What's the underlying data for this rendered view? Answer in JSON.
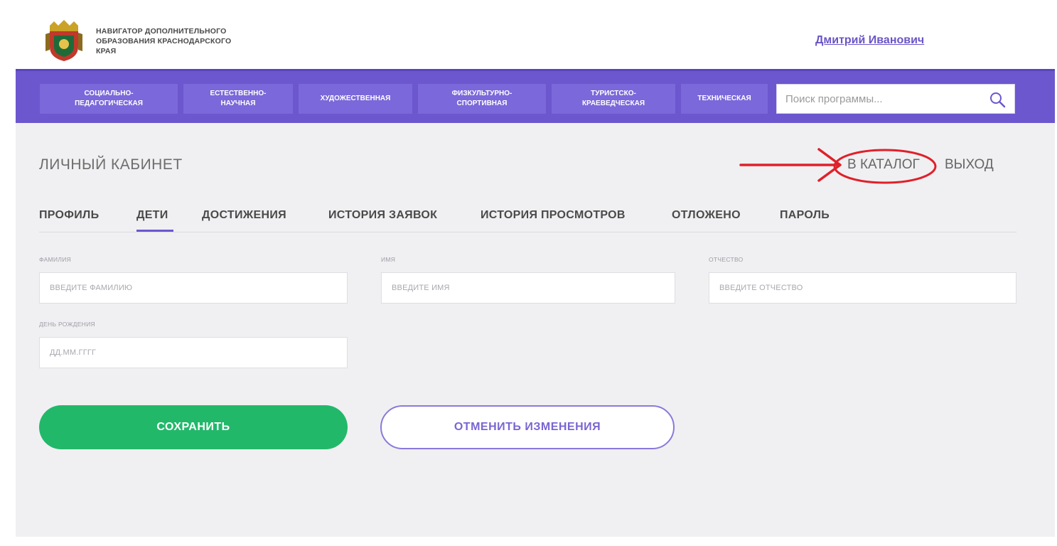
{
  "header": {
    "brand_line1": "НАВИГАТОР ДОПОЛНИТЕЛЬНОГО",
    "brand_line2": "ОБРАЗОВАНИЯ КРАСНОДАРСКОГО",
    "brand_line3": "КРАЯ",
    "user_name": "Дмитрий Иванович",
    "logo_icon": "coat-of-arms-icon"
  },
  "nav": {
    "items": [
      {
        "line1": "СОЦИАЛЬНО-",
        "line2": "ПЕДАГОГИЧЕСКАЯ"
      },
      {
        "line1": "ЕСТЕСТВЕННО-",
        "line2": "НАУЧНАЯ"
      },
      {
        "line1": "ХУДОЖЕСТВЕННАЯ",
        "line2": ""
      },
      {
        "line1": "ФИЗКУЛЬТУРНО-",
        "line2": "СПОРТИВНАЯ"
      },
      {
        "line1": "ТУРИСТСКО-",
        "line2": "КРАЕВЕДЧЕСКАЯ"
      },
      {
        "line1": "ТЕХНИЧЕСКАЯ",
        "line2": ""
      }
    ],
    "search_placeholder": "Поиск программы...",
    "search_icon": "search-icon",
    "accent_color": "#6c57cf"
  },
  "cabinet": {
    "title": "ЛИЧНЫЙ КАБИНЕТ",
    "catalog_link": "В КАТАЛОГ",
    "logout_link": "ВЫХОД",
    "annotation_color": "#e0202a"
  },
  "tabs": [
    {
      "label": "ПРОФИЛЬ"
    },
    {
      "label": "ДЕТИ",
      "active": true
    },
    {
      "label": "ДОСТИЖЕНИЯ"
    },
    {
      "label": "ИСТОРИЯ ЗАЯВОК"
    },
    {
      "label": "ИСТОРИЯ ПРОСМОТРОВ"
    },
    {
      "label": "ОТЛОЖЕНО"
    },
    {
      "label": "ПАРОЛЬ"
    }
  ],
  "form": {
    "surname_label": "ФАМИЛИЯ",
    "surname_placeholder": "ВВЕДИТЕ ФАМИЛИЮ",
    "name_label": "ИМЯ",
    "name_placeholder": "ВВЕДИТЕ ИМЯ",
    "patronymic_label": "ОТЧЕСТВО",
    "patronymic_placeholder": "ВВЕДИТЕ ОТЧЕСТВО",
    "birthday_label": "ДЕНЬ РОЖДЕНИЯ",
    "birthday_placeholder": "ДД.ММ.ГГГГ"
  },
  "buttons": {
    "save": "СОХРАНИТЬ",
    "cancel": "ОТМЕНИТЬ ИЗМЕНЕНИЯ",
    "save_color": "#22b86a"
  }
}
